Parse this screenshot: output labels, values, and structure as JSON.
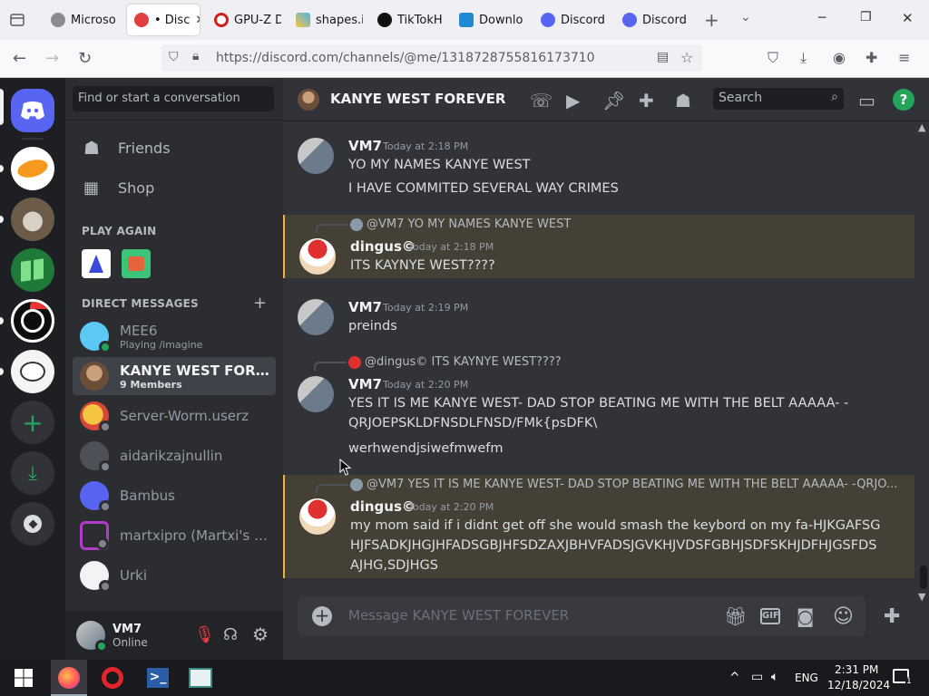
{
  "browser": {
    "tabs": [
      {
        "title": "Microso"
      },
      {
        "title": "• Disc"
      },
      {
        "title": "GPU-Z D"
      },
      {
        "title": "shapes.i"
      },
      {
        "title": "TikTokH"
      },
      {
        "title": "Downlo"
      },
      {
        "title": "Discord"
      },
      {
        "title": "Discord"
      }
    ],
    "url": "https://discord.com/channels/@me/1318728755816173710"
  },
  "dm_sidebar": {
    "search_placeholder": "Find or start a conversation",
    "friends": "Friends",
    "shop": "Shop",
    "play_again": "PLAY AGAIN",
    "direct_messages": "DIRECT MESSAGES",
    "add": "+",
    "dms": [
      {
        "name": "MEE6",
        "sub": "Playing /imagine",
        "color": "#5bc8f5"
      },
      {
        "name": "KANYE WEST FOREV...",
        "sub": "9 Members",
        "color": "#8a6a52"
      },
      {
        "name": "Server-Worm.userz",
        "sub": "",
        "color": "#f5c542"
      },
      {
        "name": "aidarikzajnullin",
        "sub": "",
        "color": "#4e5058"
      },
      {
        "name": "Bambus",
        "sub": "",
        "color": "#5865f2"
      },
      {
        "name": "martxipro (Martxi's ve...",
        "sub": "",
        "color": "#b13bc8"
      },
      {
        "name": "Urki",
        "sub": "",
        "color": "#f2f3f5"
      }
    ],
    "user": {
      "name": "VM7",
      "status": "Online"
    }
  },
  "chat": {
    "channel": "KANYE WEST FOREVER",
    "search_placeholder": "Search",
    "messages": [
      {
        "author": "VM7",
        "time": "Today at 2:18 PM",
        "lines": [
          "YO MY NAMES KANYE WEST",
          "I HAVE COMMITED SEVERAL WAY CRIMES"
        ]
      },
      {
        "reply": "@VM7 YO MY NAMES KANYE WEST",
        "author": "dingus©",
        "time": "Today at 2:18 PM",
        "lines": [
          "ITS KAYNYE WEST????"
        ]
      },
      {
        "author": "VM7",
        "time": "Today at 2:19 PM",
        "lines": [
          "preinds"
        ]
      },
      {
        "reply": "@dingus© ITS KAYNYE WEST????",
        "author": "VM7",
        "time": "Today at 2:20 PM",
        "lines": [
          "YES IT IS ME KANYE WEST- DAD STOP BEATING ME WITH THE BELT AAAAA- -QRJOEPSKLDFNSDLFNSD/FMk{psDFK\\",
          "werhwendjsiwefmwefm"
        ]
      },
      {
        "reply": "@VM7 YES IT IS ME KANYE WEST- DAD STOP BEATING ME WITH THE BELT AAAAA- -QRJO...",
        "author": "dingus©",
        "time": "Today at 2:20 PM",
        "lines": [
          "my mom said if i didnt get off she would smash the keybord on my fa-HJKGAFSGHJFSADKJHGJHFADSGBJHFSDZAXJBHVFADSJGVKHJVDSFGBHJSDFSKHJDFHJGSFDSAJHG,SDJHGS"
        ]
      }
    ],
    "composer_placeholder": "Message KANYE WEST FOREVER"
  },
  "taskbar": {
    "lang": "ENG",
    "time": "2:31 PM",
    "date": "12/18/2024",
    "notif": "1"
  },
  "colors": {
    "blurple": "#5865f2",
    "green": "#23a55a",
    "mention_bg": "#444035",
    "mention_bar": "#f0b232"
  }
}
